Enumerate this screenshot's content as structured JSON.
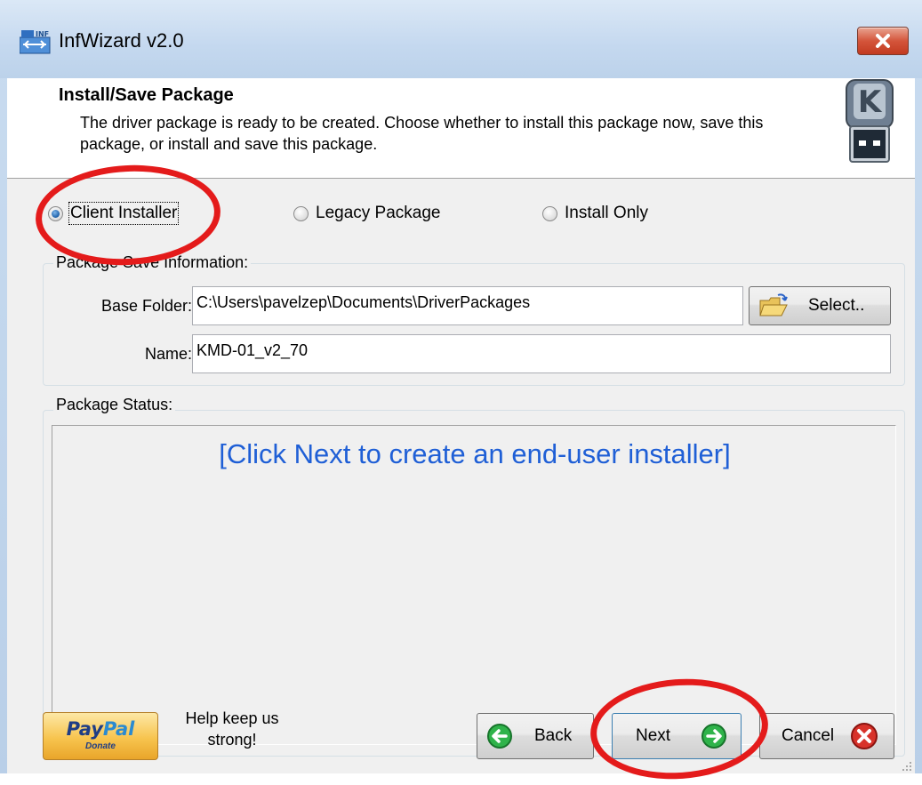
{
  "window": {
    "title": "InfWizard v2.0",
    "icon": "usb-driver-icon",
    "close_icon": "close-icon"
  },
  "header": {
    "title": "Install/Save Package",
    "description": "The driver package is ready to be created. Choose whether to install this package now, save this package, or install and save this package.",
    "icon": "usb-k-drive-icon"
  },
  "install_mode": {
    "options": [
      {
        "label": "Client Installer",
        "checked": true
      },
      {
        "label": "Legacy Package",
        "checked": false
      },
      {
        "label": "Install Only",
        "checked": false
      }
    ]
  },
  "package_save": {
    "legend": "Package Save Information:",
    "base_folder_label": "Base Folder:",
    "base_folder_value": "C:\\Users\\pavelzep\\Documents\\DriverPackages",
    "select_label": "Select..",
    "name_label": "Name:",
    "name_value": "KMD-01_v2_70"
  },
  "package_status": {
    "legend": "Package Status:",
    "message": "[Click Next to create an end-user installer]"
  },
  "footer": {
    "paypal_text_1": "Pay",
    "paypal_text_2": "Pal",
    "paypal_donate": "Donate",
    "help_text": "Help keep us strong!",
    "back_label": "Back",
    "next_label": "Next",
    "cancel_label": "Cancel"
  },
  "colors": {
    "status_text": "#1f5fd6",
    "annotation": "#e41b1b"
  }
}
